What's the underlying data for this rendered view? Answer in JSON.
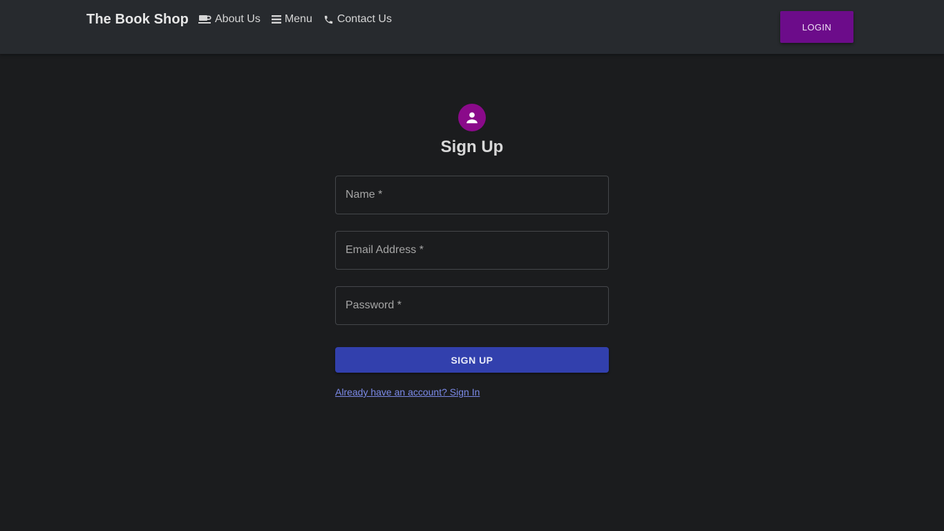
{
  "header": {
    "brand": "The Book Shop",
    "nav": [
      {
        "label": "About Us",
        "icon": "coffee-icon"
      },
      {
        "label": "Menu",
        "icon": "hamburger-menu-icon"
      },
      {
        "label": "Contact Us",
        "icon": "phone-icon"
      }
    ],
    "login_label": "LOGIN"
  },
  "form": {
    "title": "Sign Up",
    "avatar_icon": "person-icon",
    "fields": {
      "name": {
        "label": "Name *",
        "value": ""
      },
      "email": {
        "label": "Email Address *",
        "value": ""
      },
      "password": {
        "label": "Password *",
        "value": ""
      }
    },
    "submit_label": "SIGN UP",
    "signin_link": "Already have an account? Sign In"
  },
  "colors": {
    "background": "#1b1c1e",
    "navbar": "#272a2e",
    "login_button": "#6c0c8a",
    "avatar": "#8a0a8a",
    "primary_button": "#3240ad",
    "link": "#7b8ae8"
  }
}
